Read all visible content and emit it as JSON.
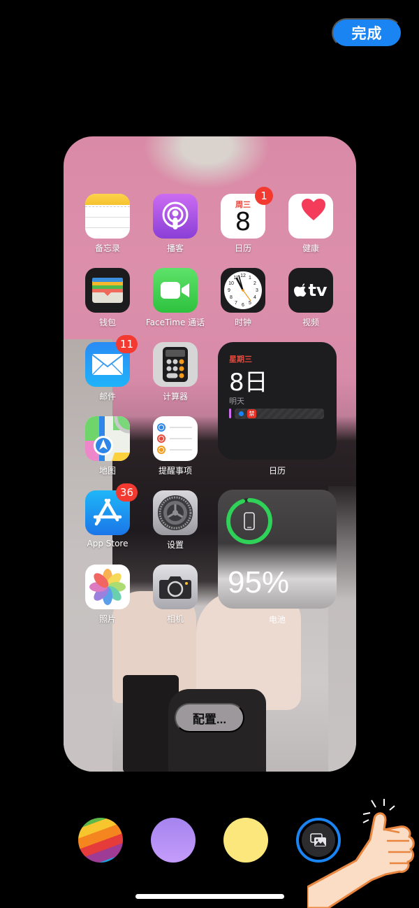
{
  "header": {
    "done_label": "完成"
  },
  "apps": [
    {
      "name": "notes",
      "label": "备忘录",
      "icon": "notes-icon"
    },
    {
      "name": "podcasts",
      "label": "播客",
      "icon": "podcasts-icon"
    },
    {
      "name": "calendar",
      "label": "日历",
      "icon": "calendar-icon",
      "weekday": "周三",
      "day": "8",
      "badge": "1"
    },
    {
      "name": "health",
      "label": "健康",
      "icon": "health-heart-icon"
    },
    {
      "name": "wallet",
      "label": "钱包",
      "icon": "wallet-icon"
    },
    {
      "name": "facetime",
      "label": "FaceTime 通话",
      "icon": "facetime-icon"
    },
    {
      "name": "clock",
      "label": "时钟",
      "icon": "clock-icon"
    },
    {
      "name": "tv",
      "label": "视频",
      "icon": "apple-tv-icon",
      "icon_text": "tv"
    },
    {
      "name": "mail",
      "label": "邮件",
      "icon": "mail-icon",
      "badge": "11"
    },
    {
      "name": "calculator",
      "label": "计算器",
      "icon": "calculator-icon"
    },
    {
      "name": "maps",
      "label": "地图",
      "icon": "maps-icon"
    },
    {
      "name": "reminders",
      "label": "提醒事项",
      "icon": "reminders-icon"
    },
    {
      "name": "app-store",
      "label": "App Store",
      "icon": "app-store-icon",
      "badge": "36"
    },
    {
      "name": "settings",
      "label": "设置",
      "icon": "settings-gear-icon"
    },
    {
      "name": "photos",
      "label": "照片",
      "icon": "photos-icon"
    },
    {
      "name": "camera",
      "label": "相机",
      "icon": "camera-icon"
    }
  ],
  "calendar_widget": {
    "weekday": "星期三",
    "day": "8日",
    "next_label": "明天",
    "event_tag": "禁",
    "label": "日历"
  },
  "battery_widget": {
    "percent_text": "95%",
    "level": 0.95,
    "label": "电池",
    "ring_color": "#30d158"
  },
  "config_label": "配置...",
  "swatches": [
    {
      "name": "rainbow",
      "selected": false
    },
    {
      "name": "purple",
      "color": "#b98af4",
      "selected": false
    },
    {
      "name": "yellow",
      "color": "#fbe77c",
      "selected": false
    },
    {
      "name": "photo",
      "selected": true,
      "ring_color": "#1a84f3"
    }
  ],
  "colors": {
    "accent": "#1a84f3",
    "badge": "#f23a30"
  }
}
